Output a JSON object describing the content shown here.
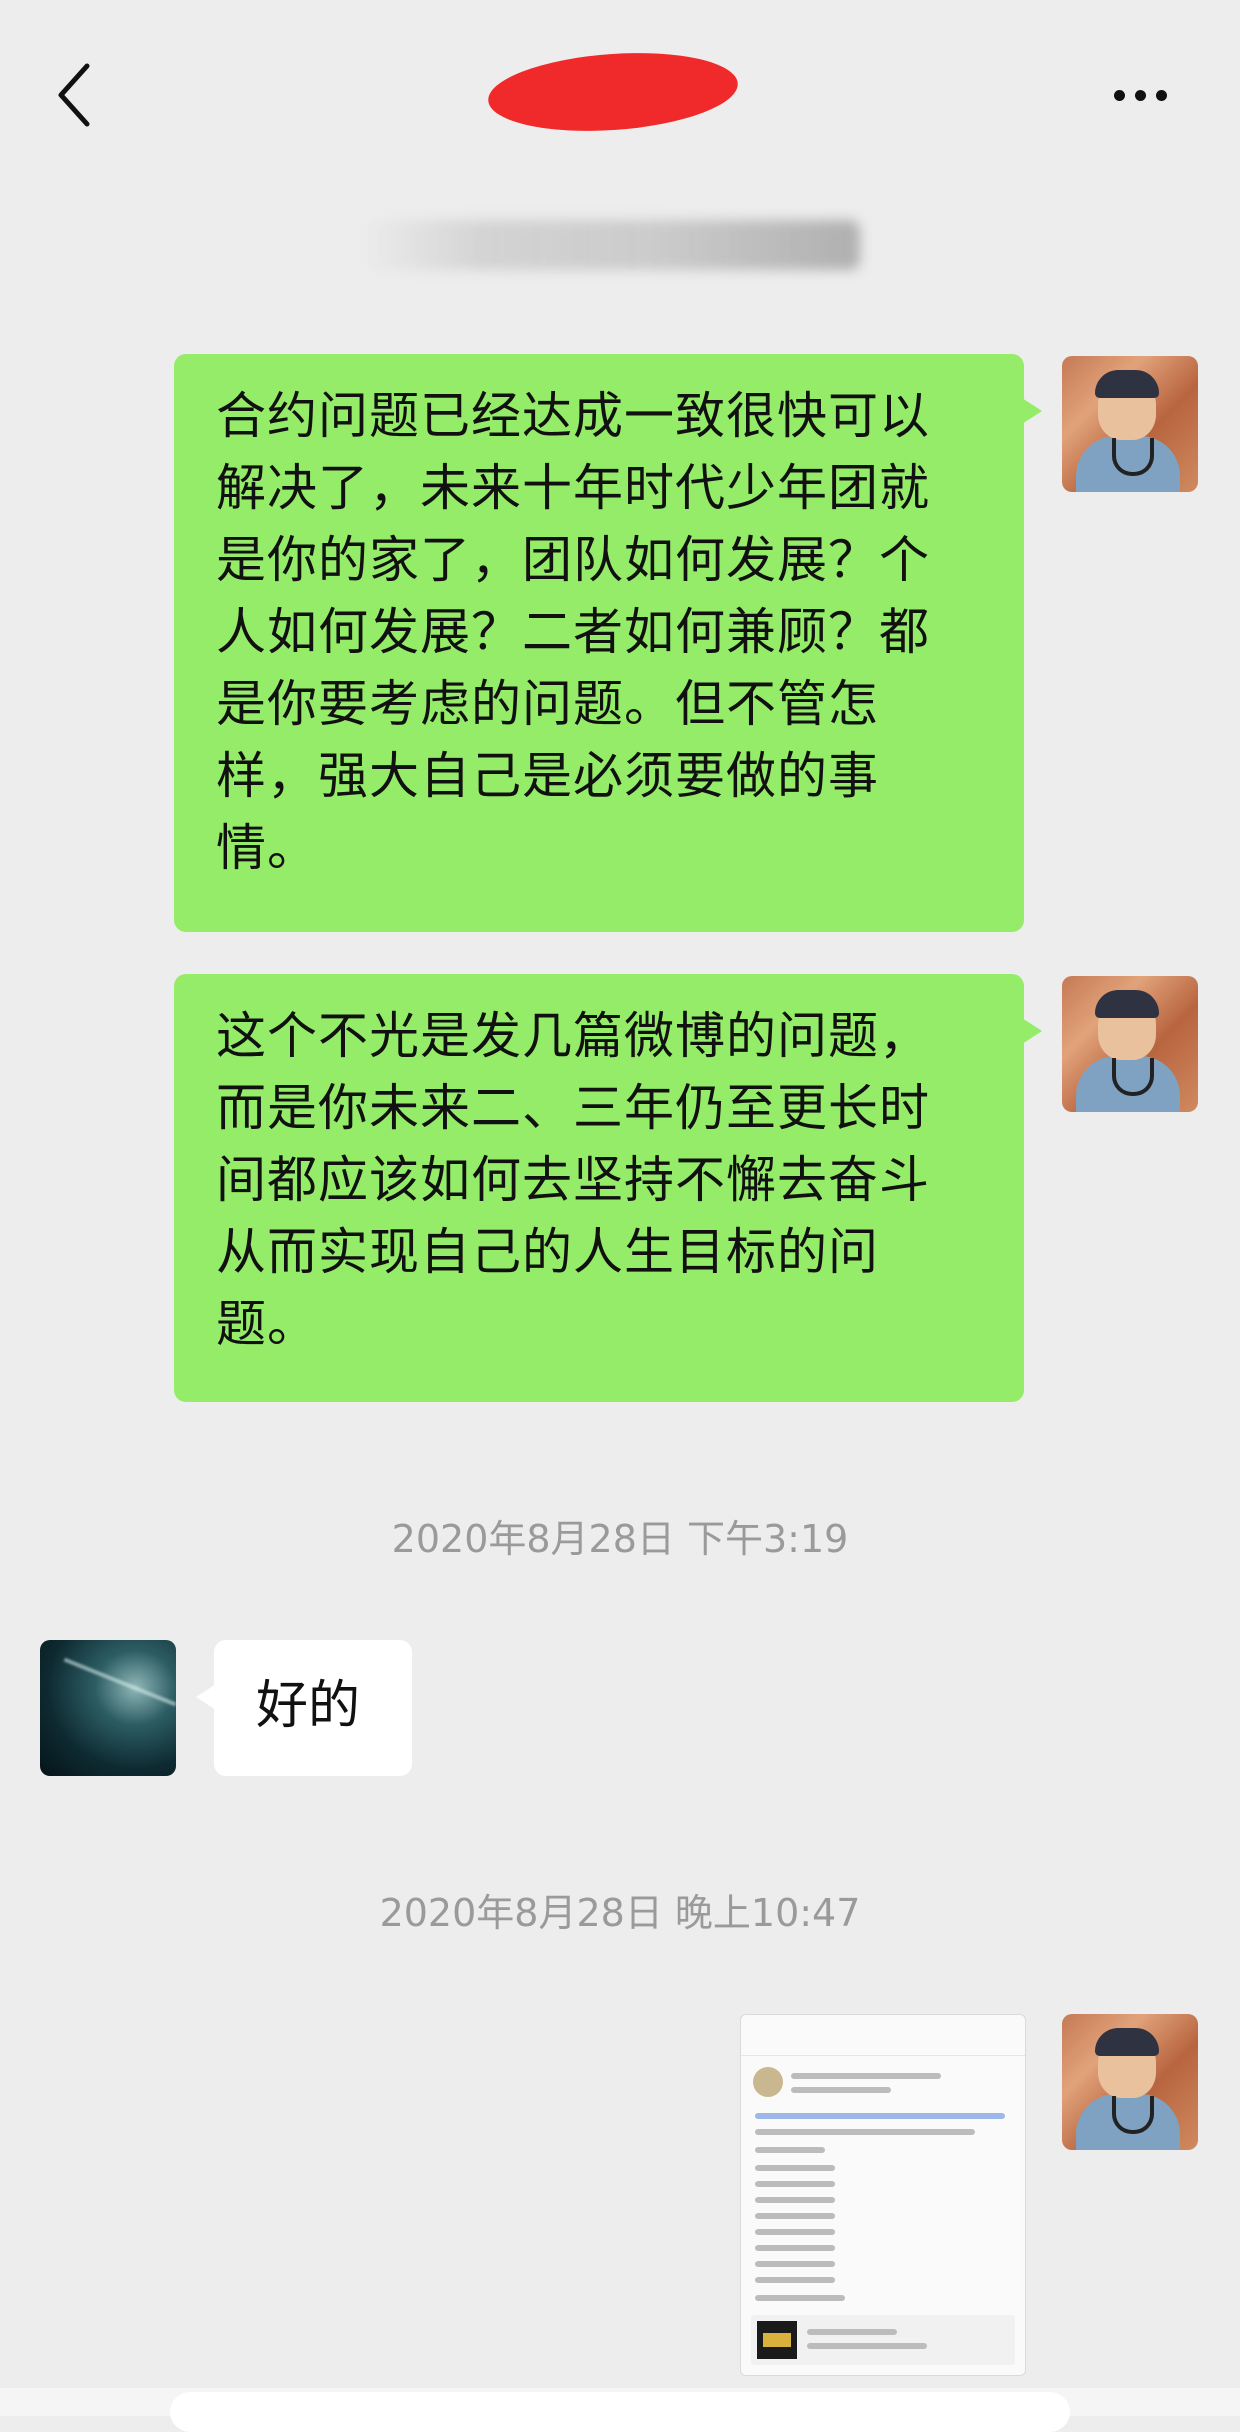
{
  "header": {
    "back_icon": "chevron-left-icon",
    "title": "",
    "more_icon": "more-dots-icon"
  },
  "messages": [
    {
      "side": "right",
      "text": "合约问题已经达成一致很快可以解决了，未来十年时代少年团就是你的家了，团队如何发展？个人如何发展？二者如何兼顾？都是你要考虑的问题。但不管怎样，强大自己是必须要做的事情。"
    },
    {
      "side": "right",
      "text": "这个不光是发几篇微博的问题，而是你未来二、三年仍至更长时间都应该如何去坚持不懈去奋斗从而实现自己的人生目标的问题。"
    },
    {
      "side": "left",
      "text": "好的"
    }
  ],
  "timestamps": {
    "first": "2020年8月28日 下午3:19",
    "second": "2020年8月28日 晚上10:47"
  },
  "colors": {
    "background": "#ededed",
    "bubble_green": "#95ec69",
    "bubble_white": "#ffffff",
    "timestamp": "#9a9a9a",
    "redaction": "#f02a2a"
  }
}
